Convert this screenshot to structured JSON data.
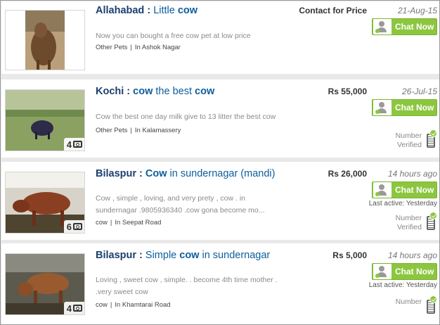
{
  "listings": [
    {
      "city": "Allahabad",
      "title_parts": [
        "Little ",
        "cow",
        ""
      ],
      "description": "Now you can bought a free cow pet at low price",
      "category": "Other Pets",
      "location": "In Ashok Nagar",
      "price": "Contact for Price",
      "date": "21-Aug-15",
      "chat_label": "Chat Now",
      "photo_count": "",
      "last_active": "",
      "verify_line1": "",
      "verify_line2": ""
    },
    {
      "city": "Kochi",
      "title_parts": [
        "cow",
        " the best ",
        "cow"
      ],
      "description": "Cow the best one day milk give to 13 litter the best cow",
      "category": "Other Pets",
      "location": "In Kalamassery",
      "price": "Rs 55,000",
      "date": "26-Jul-15",
      "chat_label": "Chat Now",
      "photo_count": "4",
      "last_active": "",
      "verify_line1": "Number",
      "verify_line2": "Verified"
    },
    {
      "city": "Bilaspur",
      "title_parts": [
        "Cow",
        " in sundernagar (mandi)",
        ""
      ],
      "description": "Cow , simple , loving, and very prety , cow . in sundernagar .9805936340 .cow gona become mo...",
      "category": "cow",
      "location": "In Seepat Road",
      "price": "Rs 26,000",
      "date": "14 hours ago",
      "chat_label": "Chat Now",
      "photo_count": "6",
      "last_active": "Last active: Yesterday",
      "verify_line1": "Number",
      "verify_line2": "Verified"
    },
    {
      "city": "Bilaspur",
      "title_parts": [
        "Simple ",
        "cow",
        " in sundernagar"
      ],
      "description": "Loving , sweet cow , simple. . become 4th time mother . .very sweet cow",
      "category": "cow",
      "location": "In Khamtarai Road",
      "price": "Rs 5,000",
      "date": "14 hours ago",
      "chat_label": "Chat Now",
      "photo_count": "4",
      "last_active": "Last active: Yesterday",
      "verify_line1": "Number",
      "verify_line2": ""
    }
  ]
}
